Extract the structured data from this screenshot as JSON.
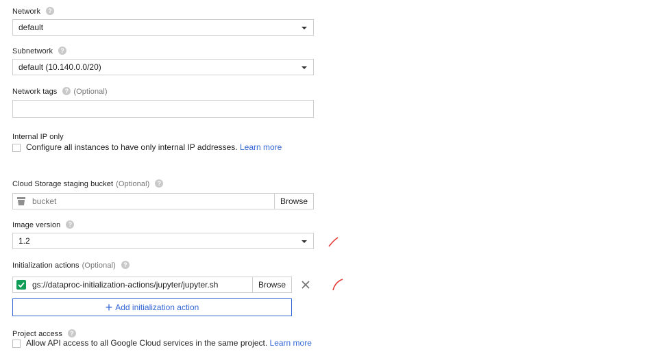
{
  "network": {
    "label": "Network",
    "value": "default"
  },
  "subnetwork": {
    "label": "Subnetwork",
    "value": "default (10.140.0.0/20)"
  },
  "network_tags": {
    "label": "Network tags",
    "optional": "(Optional)",
    "value": ""
  },
  "internal_ip": {
    "label": "Internal IP only",
    "checkbox_text": "Configure all instances to have only internal IP addresses.",
    "learn_more": "Learn more"
  },
  "staging_bucket": {
    "label": "Cloud Storage staging bucket",
    "optional": "(Optional)",
    "placeholder": "bucket",
    "browse": "Browse"
  },
  "image_version": {
    "label": "Image version",
    "value": "1.2"
  },
  "init_actions": {
    "label": "Initialization actions",
    "optional": "(Optional)",
    "items": [
      {
        "path": "gs://dataproc-initialization-actions/jupyter/jupyter.sh",
        "browse": "Browse"
      }
    ],
    "add_label": "Add initialization action"
  },
  "project_access": {
    "label": "Project access",
    "checkbox_text": "Allow API access to all Google Cloud services in the same project.",
    "learn_more": "Learn more"
  },
  "colors": {
    "link": "#3367d6",
    "check": "#0f9d58",
    "annotation": "#e53935"
  },
  "icons": [
    "help-icon",
    "chevron-down-icon",
    "bucket-icon",
    "checkbox-checked-icon",
    "close-icon",
    "plus-icon"
  ]
}
